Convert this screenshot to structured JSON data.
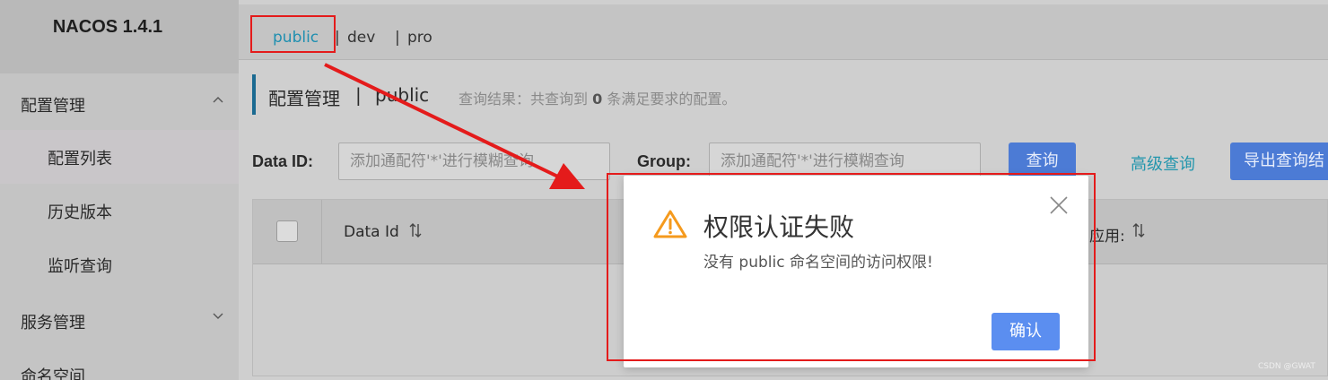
{
  "app": {
    "title": "NACOS 1.4.1"
  },
  "sidebar": {
    "config_group": "配置管理",
    "config_items": [
      {
        "label": "配置列表",
        "active": true
      },
      {
        "label": "历史版本"
      },
      {
        "label": "监听查询"
      }
    ],
    "service_group": "服务管理",
    "namespace_group": "命名空间"
  },
  "namespaces": {
    "items": [
      "public",
      "dev",
      "pro"
    ],
    "separator": "|",
    "current": "public"
  },
  "page": {
    "title": "配置管理",
    "separator": "|",
    "namespace": "public",
    "result_prefix": "查询结果：共查询到 ",
    "result_count": "0",
    "result_suffix": " 条满足要求的配置。"
  },
  "search": {
    "data_id_label": "Data ID:",
    "data_id_placeholder": "添加通配符'*'进行模糊查询",
    "group_label": "Group:",
    "group_placeholder": "添加通配符'*'进行模糊查询",
    "query_button": "查询",
    "advanced_query": "高级查询",
    "export_button": "导出查询结"
  },
  "table": {
    "columns": [
      "Data Id",
      "应用:"
    ]
  },
  "dialog": {
    "title": "权限认证失败",
    "message": "没有 public 命名空间的访问权限!",
    "confirm_button": "确认"
  },
  "colors": {
    "annotation_red": "#e41b1b",
    "primary_blue": "#5b8ef0",
    "warning_orange": "#f59a1d",
    "link_teal": "#1f8fb0"
  },
  "watermark": "CSDN @GWAT"
}
